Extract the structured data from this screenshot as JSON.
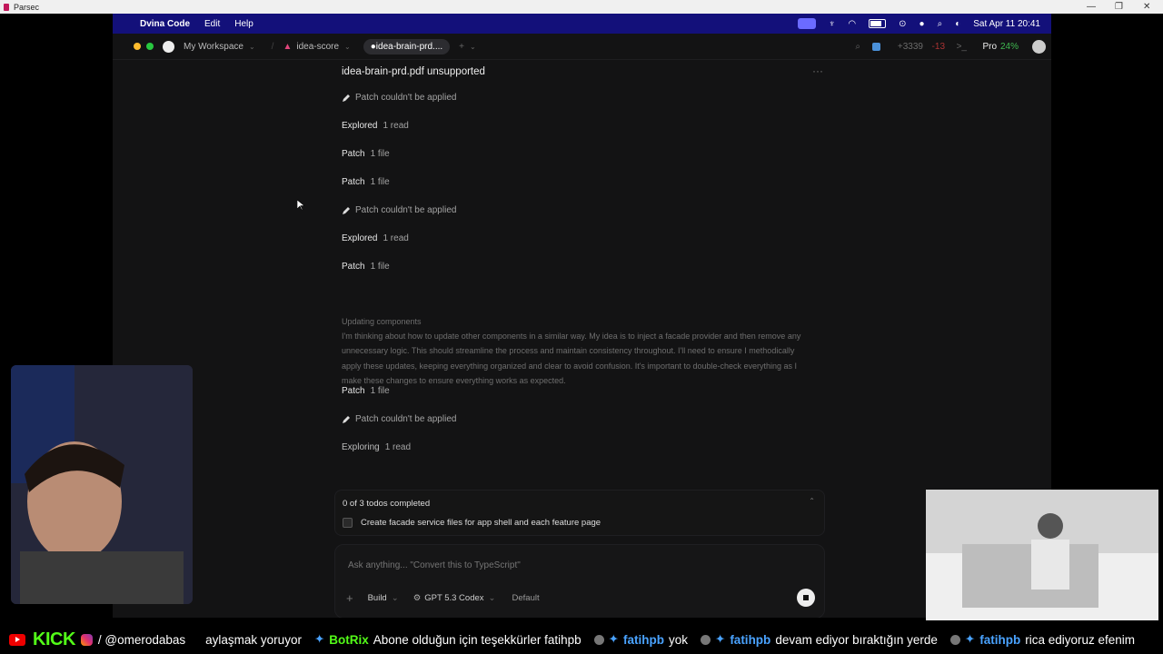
{
  "parsec": {
    "title": "Parsec",
    "minimize": "—",
    "restore": "❐",
    "close": "✕"
  },
  "menubar": {
    "app": "Dvina Code",
    "edit": "Edit",
    "help": "Help",
    "clock": "Sat Apr 11  20:41"
  },
  "tabbar": {
    "workspace": "My Workspace",
    "project": "idea-score",
    "active_tab": "●idea-brain-prd....",
    "plus": "+",
    "diff_add": "+3339",
    "diff_del": "-13",
    "terminal": ">_",
    "plan": "Pro",
    "usage": "24%"
  },
  "main": {
    "title": "idea-brain-prd.pdf unsupported",
    "more": "···",
    "rows": [
      {
        "type": "fail",
        "value": "Patch couldn't be applied"
      },
      {
        "type": "kv",
        "key": "Explored",
        "value": "1 read"
      },
      {
        "type": "kv",
        "key": "Patch",
        "value": "1 file"
      },
      {
        "type": "kv",
        "key": "Patch",
        "value": "1 file"
      },
      {
        "type": "fail",
        "value": "Patch couldn't be applied"
      },
      {
        "type": "kv",
        "key": "Explored",
        "value": "1 read"
      },
      {
        "type": "kv",
        "key": "Patch",
        "value": "1 file"
      },
      {
        "type": "kv",
        "key": "Patch",
        "value": "1 file"
      },
      {
        "type": "fail",
        "value": "Patch couldn't be applied"
      },
      {
        "type": "kv",
        "key": "Exploring",
        "value": "1 read"
      }
    ],
    "thinking_title": "Updating components",
    "thinking_body": "I'm thinking about how to update other components in a similar way. My idea is to inject a facade provider and then remove any unnecessary logic. This should streamline the process and maintain consistency throughout. I'll need to ensure I methodically apply these updates, keeping everything organized and clear to avoid confusion. It's important to double-check everything as I make these changes to ensure everything works as expected."
  },
  "todos": {
    "header": "0 of 3 todos completed",
    "item": "Create facade service files for app shell and each feature page"
  },
  "composer": {
    "placeholder": "Ask anything... \"Convert this to TypeScript\"",
    "mode": "Build",
    "model": "GPT 5.3 Codex",
    "preset": "Default"
  },
  "ticker": {
    "handle": "/ @omerodabas",
    "seg1": "aylaşmak yoruyor",
    "bot": "BotRix",
    "seg2": "Abone olduğun için teşekkürler fatihpb",
    "user1": "fatihpb",
    "seg3": "yok",
    "user2": "fatihpb",
    "seg4": "devam ediyor bıraktığın yerde",
    "user3": "fatihpb",
    "seg5": "rica ediyoruz efenim"
  },
  "colors": {
    "menubar": "#13107a",
    "accent_green": "#53fc18",
    "diff_add": "#3fb950",
    "diff_del": "#f85149",
    "user": "#4aa3ff"
  }
}
